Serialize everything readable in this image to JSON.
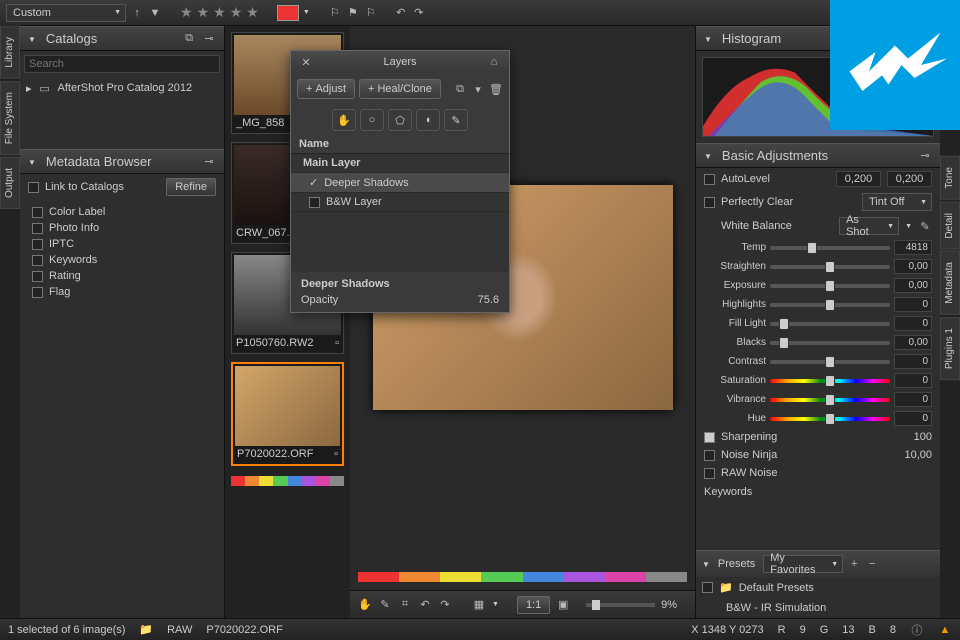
{
  "toolbar": {
    "custom_label": "Custom",
    "layer_dropdown": "Main Layer"
  },
  "left": {
    "catalogs_title": "Catalogs",
    "search_placeholder": "Search",
    "catalog_item": "AfterShot Pro Catalog 2012",
    "meta_title": "Metadata Browser",
    "link_label": "Link to Catalogs",
    "refine_btn": "Refine",
    "meta_items": [
      "Color Label",
      "Photo Info",
      "IPTC",
      "Keywords",
      "Rating",
      "Flag"
    ],
    "vtabs": [
      "Library",
      "File System",
      "Output"
    ]
  },
  "thumbs": [
    {
      "name": "_MG_858"
    },
    {
      "name": "CRW_067..."
    },
    {
      "name": "P1050760.RW2"
    },
    {
      "name": "P7020022.ORF"
    }
  ],
  "layers": {
    "title": "Layers",
    "adjust": "Adjust",
    "heal": "Heal/Clone",
    "name_hdr": "Name",
    "main": "Main Layer",
    "deeper": "Deeper Shadows",
    "bw": "B&W Layer",
    "sel_name": "Deeper Shadows",
    "opacity_lbl": "Opacity",
    "opacity_val": "75.6"
  },
  "right": {
    "histogram_title": "Histogram",
    "basic_title": "Basic Adjustments",
    "autolevel": "AutoLevel",
    "autolevel_v1": "0,200",
    "autolevel_v2": "0,200",
    "perfectly": "Perfectly Clear",
    "tint": "Tint Off",
    "wb": "White Balance",
    "wb_val": "As Shot",
    "adjustments": [
      {
        "label": "Temp",
        "value": "4818",
        "pos": 35
      },
      {
        "label": "Straighten",
        "value": "0,00",
        "pos": 50
      },
      {
        "label": "Exposure",
        "value": "0,00",
        "pos": 50
      },
      {
        "label": "Highlights",
        "value": "0",
        "pos": 50
      },
      {
        "label": "Fill Light",
        "value": "0",
        "pos": 12
      },
      {
        "label": "Blacks",
        "value": "0,00",
        "pos": 12
      },
      {
        "label": "Contrast",
        "value": "0",
        "pos": 50
      },
      {
        "label": "Saturation",
        "value": "0",
        "pos": 50,
        "rainbow": true
      },
      {
        "label": "Vibrance",
        "value": "0",
        "pos": 50,
        "rainbow": true
      },
      {
        "label": "Hue",
        "value": "0",
        "pos": 50,
        "rainbow": true
      }
    ],
    "sharpening": "Sharpening",
    "sharp_val": "100",
    "noise": "Noise Ninja",
    "noise_val": "10,00",
    "raw": "RAW Noise",
    "keywords": "Keywords",
    "presets_title": "Presets",
    "presets_drop": "My Favorites",
    "default_presets": "Default Presets",
    "preset_item": "B&W - IR Simulation",
    "vtabs": [
      "Tone",
      "Detail",
      "Metadata",
      "Plugins 1"
    ]
  },
  "viewer": {
    "zoom": "9%",
    "onetoone": "1:1"
  },
  "status": {
    "selection": "1 selected of 6 image(s)",
    "folder": "RAW",
    "file": "P7020022.ORF",
    "coords": "X 1348  Y 0273",
    "r": "R",
    "g": "G",
    "b": "B",
    "r_v": "9",
    "g_v": "13",
    "b_v": "8"
  }
}
